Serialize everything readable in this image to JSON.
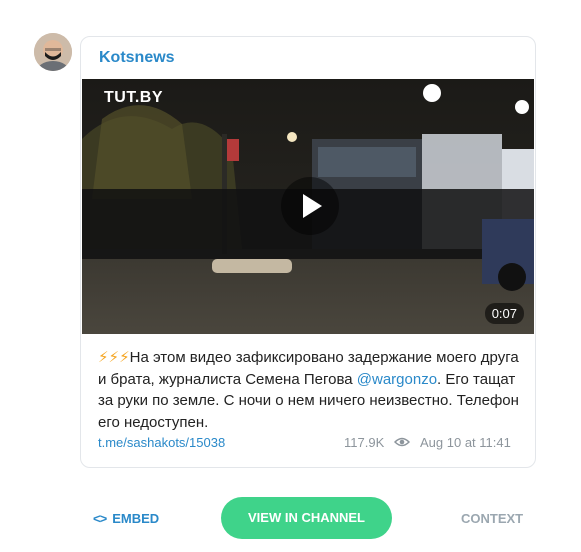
{
  "channel": {
    "name": "Kotsnews"
  },
  "video": {
    "watermark": "TUT.BY",
    "duration": "0:07"
  },
  "post": {
    "emoji": "⚡⚡⚡",
    "text_part1": "На этом видео зафиксировано задержание моего друга и брата, журналиста Семена Пегова ",
    "mention": "@wargonzo",
    "text_part2": ". Его тащат за руки по земле. С ночи о нем ничего неизвестно. Телефон его недоступен."
  },
  "meta": {
    "link": "t.me/sashakots/15038",
    "views": "117.9K",
    "date": "Aug 10 at 11:41"
  },
  "actions": {
    "embed": "EMBED",
    "view_channel": "VIEW IN CHANNEL",
    "context": "CONTEXT"
  },
  "icons": {
    "embed_icon": "code-brackets-icon",
    "views_icon": "eye-icon",
    "play_icon": "play-icon"
  },
  "colors": {
    "accent": "#2a89c9",
    "button": "#3fd38a",
    "muted": "#9ba7b0"
  }
}
